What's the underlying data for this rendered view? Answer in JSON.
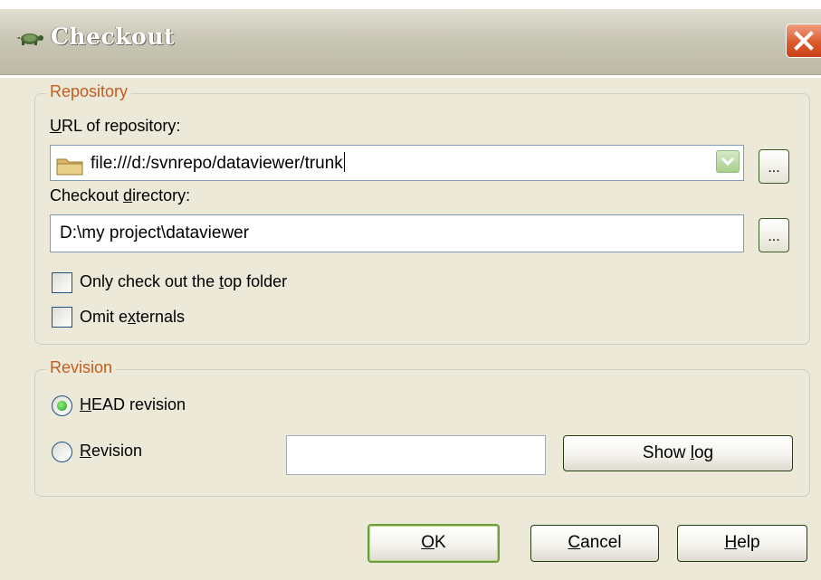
{
  "window": {
    "title": "Checkout",
    "app_icon": "tortoise-icon",
    "close_icon": "close-icon"
  },
  "repository": {
    "group_label": "Repository",
    "url_label_prefix": "",
    "url_label_accel": "U",
    "url_label_rest": "RL of repository:",
    "url_value": "file:///d:/svnrepo/dataviewer/trunk",
    "checkout_label_prefix": "Checkout ",
    "checkout_label_accel": "d",
    "checkout_label_rest": "irectory:",
    "checkout_value": "D:\\my project\\dataviewer",
    "browse_label": "...",
    "only_top_prefix": "Only check out the ",
    "only_top_accel": "t",
    "only_top_rest": "op folder",
    "only_top_checked": false,
    "omit_prefix": "Omit e",
    "omit_accel": "x",
    "omit_rest": "ternals",
    "omit_checked": false
  },
  "revision": {
    "group_label": "Revision",
    "head_accel": "H",
    "head_rest": "EAD revision",
    "head_selected": true,
    "rev_accel": "R",
    "rev_rest": "evision",
    "rev_selected": false,
    "rev_value": "",
    "show_log_prefix": "Show ",
    "show_log_accel": "l",
    "show_log_rest": "og"
  },
  "buttons": {
    "ok_accel": "O",
    "ok_rest": "K",
    "cancel_accel": "C",
    "cancel_rest": "ancel",
    "help_accel": "H",
    "help_rest": "elp"
  }
}
